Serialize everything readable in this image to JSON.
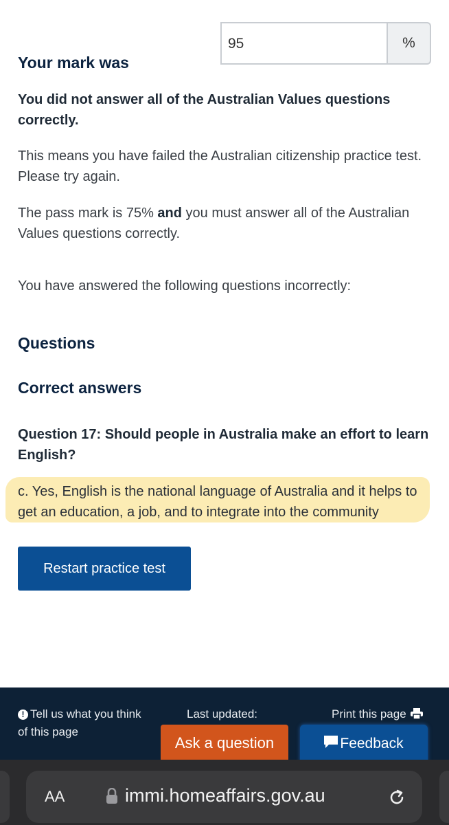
{
  "result": {
    "mark_heading": "Your mark was",
    "mark_value": "95",
    "mark_unit": "%"
  },
  "message": {
    "failed_values": "You did not answer all of the Australian Values questions correctly.",
    "means_failed": "This means you have failed the Australian citizenship practice test. Please try again.",
    "pass_mark_before": "The pass mark is 75% ",
    "pass_mark_and": "and",
    "pass_mark_after": " you must answer all of the Australian Values questions correctly.",
    "incorrect_intro": "You have answered the following questions incorrectly:"
  },
  "sections": {
    "questions_heading": "Questions",
    "answers_heading": "Correct answers"
  },
  "question": {
    "title": "Question 17: Should people in Australia make an effort to learn English?",
    "correct_answer": "c. Yes, English is the national language of Australia and it helps to get an education, a job, and to integrate into the community"
  },
  "actions": {
    "restart_label": "Restart practice test"
  },
  "footer": {
    "feedback_prompt": "Tell us what you think of this page",
    "last_updated_label": "Last updated:",
    "print_label": "Print this page",
    "ask_label": "Ask a question",
    "feedback_label": "Feedback"
  },
  "browser": {
    "text_size_label": "AA",
    "url": "immi.homeaffairs.gov.au"
  },
  "colors": {
    "heading": "#0c2340",
    "primary_button": "#0b4f94",
    "ask_button": "#d2551c",
    "footer_bg": "#0d2136",
    "highlight": "#fbe9a7"
  },
  "icons": [
    "exclamation-icon",
    "printer-icon",
    "chat-bubble-icon",
    "lock-icon",
    "reload-icon"
  ]
}
